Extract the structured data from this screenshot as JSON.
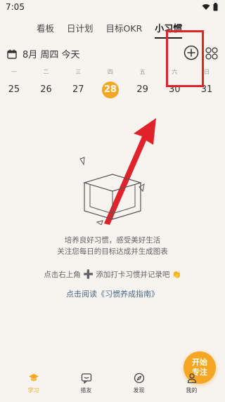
{
  "status": {
    "time": "7:05"
  },
  "tabs": [
    {
      "label": "看板",
      "active": false
    },
    {
      "label": "日计划",
      "active": false
    },
    {
      "label": "目标OKR",
      "active": false
    },
    {
      "label": "小习惯",
      "active": true
    }
  ],
  "header": {
    "date_label": "8月 周四 今天",
    "calendar_icon": "calendar-icon",
    "add_icon": "plus-circle-icon",
    "grid_icon": "grid-icon"
  },
  "week": {
    "labels": [
      "一",
      "二",
      "三",
      "四",
      "五",
      "六",
      "日"
    ],
    "days": [
      "25",
      "26",
      "27",
      "28",
      "29",
      "30",
      "31"
    ],
    "selected_day": "28"
  },
  "empty_state": {
    "line1": "培养良好习惯，感受美好生活",
    "line2": "关注您每日的目标达成并生成图表",
    "hint_before": "点击右上角",
    "hint_plus": "➕",
    "hint_after": "添加打卡习惯并记录吧",
    "hint_emoji": "👏",
    "guide_link": "点击阅读《习惯养成指南》"
  },
  "focus_button": {
    "line1": "开始",
    "line2": "专注"
  },
  "bottom_nav": [
    {
      "label": "学习",
      "icon": "graduation-cap-icon",
      "active": true
    },
    {
      "label": "搭友",
      "icon": "chat-icon",
      "active": false
    },
    {
      "label": "发现",
      "icon": "compass-icon",
      "active": false
    },
    {
      "label": "我的",
      "icon": "person-icon",
      "active": false
    }
  ],
  "colors": {
    "accent": "#f5a623",
    "highlight": "#e0232b",
    "background": "#f7f3ee",
    "link": "#4a6b8a"
  }
}
